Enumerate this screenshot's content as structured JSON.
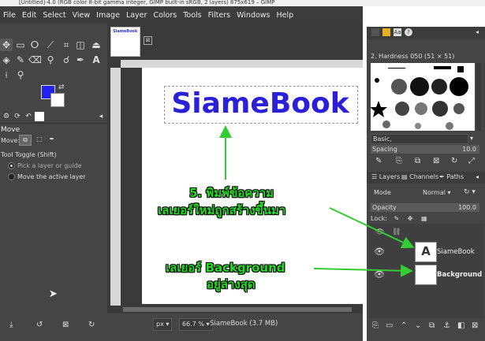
{
  "window": {
    "title": "[Untitled]-4.0 (RGB color 8-bit gamma integer, GIMP built-in sRGB, 2 layers) 875x619 – GIMP"
  },
  "menu": [
    "File",
    "Edit",
    "Select",
    "View",
    "Image",
    "Layer",
    "Colors",
    "Tools",
    "Filters",
    "Windows",
    "Help"
  ],
  "tool_options": {
    "title": "Move",
    "move_label": "Move:",
    "toggle_label": "Tool Toggle  (Shift)",
    "option_pick": "Pick a layer or guide",
    "option_move": "Move the active layer"
  },
  "image_tab": {
    "thumb_text": "SiameBook",
    "close_glyph": "⊠"
  },
  "canvas": {
    "text": "SiameBook"
  },
  "status": {
    "unit": "px",
    "zoom": "66.7 %",
    "info": "SiameBook (3.7 MB)"
  },
  "brushes": {
    "current": "2. Hardness 050 (51 × 51)",
    "preset": "Basic,",
    "spacing_label": "Spacing",
    "spacing_value": "10.0"
  },
  "layers_panel": {
    "tabs": [
      "Layers",
      "Channels",
      "Paths"
    ],
    "mode_label": "Mode",
    "mode_value": "Normal",
    "opacity_label": "Opacity",
    "opacity_value": "100.0",
    "lock_label": "Lock:",
    "layers": [
      {
        "name": "SiameBook",
        "type": "text"
      },
      {
        "name": "Background",
        "type": "image"
      }
    ]
  },
  "annotations": {
    "step_line1": "5. พิมพ์ข้อความ",
    "step_line2": "เลเยอร์ใหม่ถูกสร้างขึ้นมา",
    "bg_line1": "เลเยอร์ Background",
    "bg_line2": "อยู่ล่างสุด"
  },
  "colors": {
    "foreground": "#2222ee",
    "background": "#ffffff",
    "annotation": "#22dd22",
    "text_layer": "#2b20d8"
  }
}
